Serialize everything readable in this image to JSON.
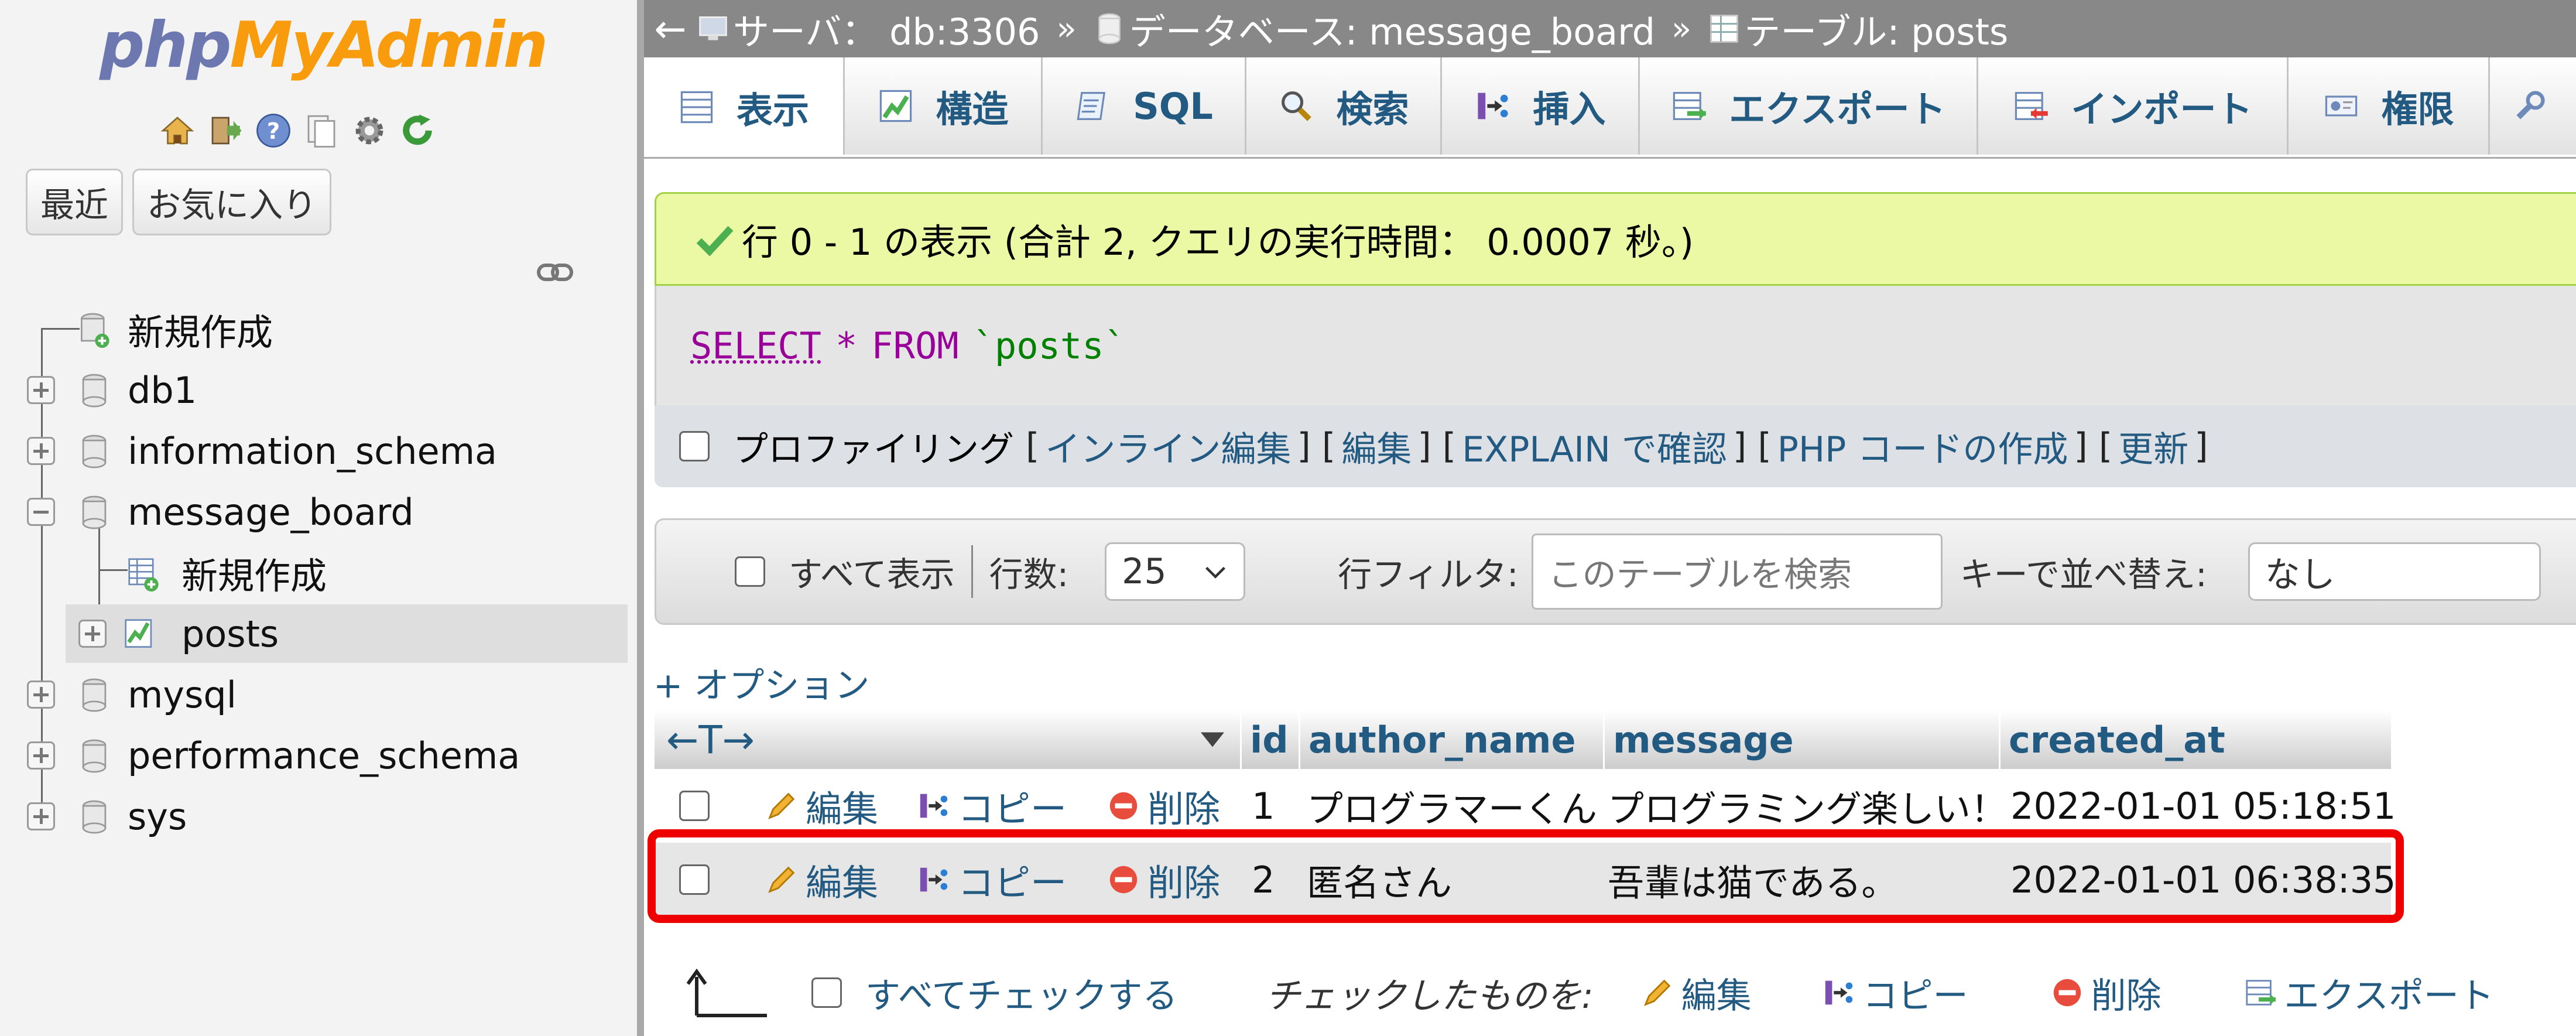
{
  "left_panel": {
    "logo": {
      "php": "php",
      "myadmin": "MyAdmin"
    },
    "nav_icons": [
      "home-icon",
      "logout-icon",
      "help-icon",
      "docs-icon",
      "settings-icon",
      "reload-icon"
    ],
    "buttons": {
      "recent": "最近",
      "favorites": "お気に入り"
    },
    "tree": {
      "new_top": "新規作成",
      "databases": [
        {
          "name": "db1",
          "expanded": false
        },
        {
          "name": "information_schema",
          "expanded": false
        },
        {
          "name": "message_board",
          "expanded": true
        },
        {
          "name": "mysql",
          "expanded": false
        },
        {
          "name": "performance_schema",
          "expanded": false
        },
        {
          "name": "sys",
          "expanded": false
        }
      ],
      "message_board_children": {
        "new": "新規作成",
        "table": "posts"
      }
    }
  },
  "breadcrumb": {
    "back": "←",
    "server": "サーバ： db:3306",
    "database": "データベース: message_board",
    "table": "テーブル: posts",
    "separator": "»"
  },
  "tabs": [
    {
      "label": "表示",
      "icon": "browse-icon",
      "active": true
    },
    {
      "label": "構造",
      "icon": "structure-icon"
    },
    {
      "label": "SQL",
      "icon": "sql-icon"
    },
    {
      "label": "検索",
      "icon": "search-icon"
    },
    {
      "label": "挿入",
      "icon": "insert-icon"
    },
    {
      "label": "エクスポート",
      "icon": "export-icon"
    },
    {
      "label": "インポート",
      "icon": "import-icon"
    },
    {
      "label": "権限",
      "icon": "privileges-icon"
    }
  ],
  "success_message": "行 0 - 1 の表示 (合計 2, クエリの実行時間： 0.0007 秒。)",
  "sql": {
    "select": "SELECT",
    "star": "*",
    "from": "FROM",
    "table": "`posts`"
  },
  "profiling": {
    "label": "プロファイリング",
    "links": [
      "インライン編集",
      "編集",
      "EXPLAIN で確認",
      "PHP コードの作成",
      "更新"
    ]
  },
  "navigation": {
    "show_all": "すべて表示",
    "rows_label": "行数:",
    "rows_value": "25",
    "filter_label": "行フィルタ:",
    "filter_placeholder": "このテーブルを検索",
    "sort_label": "キーで並べ替え:",
    "sort_value": "なし"
  },
  "options_link": "+ オプション",
  "table": {
    "arrows": "←T→",
    "columns": [
      "id",
      "author_name",
      "message",
      "created_at"
    ],
    "row_actions": {
      "edit": "編集",
      "copy": "コピー",
      "delete": "削除"
    },
    "rows": [
      {
        "id": "1",
        "author_name": "プログラマーくん",
        "message": "プログラミング楽しい！",
        "created_at": "2022-01-01 05:18:51"
      },
      {
        "id": "2",
        "author_name": "匿名さん",
        "message": "吾輩は猫である。",
        "created_at": "2022-01-01 06:38:35"
      }
    ],
    "highlight_color": "#ee0000"
  },
  "bulk_actions": {
    "check_all": "すべてチェックする",
    "with_selected": "チェックしたものを:",
    "edit": "編集",
    "copy": "コピー",
    "delete": "削除",
    "export": "エクスポート"
  },
  "colors": {
    "link": "#235a81",
    "success_bg": "#ebf8a4",
    "breadcrumb_bg": "#888888"
  }
}
